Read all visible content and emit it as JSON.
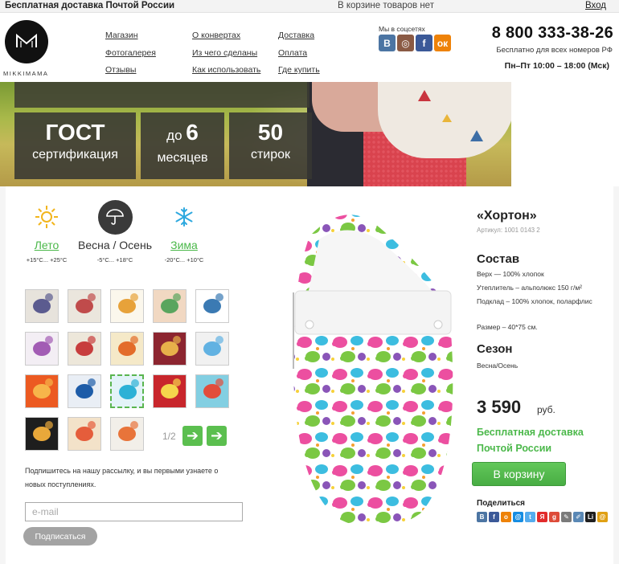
{
  "topbar": {
    "promo": "Бесплатная доставка Почтой России",
    "cart_status": "В корзине товаров нет",
    "login": "Вход"
  },
  "header": {
    "logo_text": "MIKKIMAMA",
    "nav_col1": [
      "Магазин",
      "Фотогалерея",
      "Отзывы"
    ],
    "nav_col2": [
      "О конвертах",
      "Из чего сделаны",
      "Как использовать"
    ],
    "nav_col3": [
      "Доставка",
      "Оплата",
      "Где купить"
    ],
    "social_label": "Мы в соцсетях",
    "social": [
      {
        "name": "vk-icon",
        "glyph": "B",
        "color": "#4c75a3"
      },
      {
        "name": "instagram-icon",
        "glyph": "◎",
        "color": "#8a5a44"
      },
      {
        "name": "facebook-icon",
        "glyph": "f",
        "color": "#3b5998"
      },
      {
        "name": "odnoklassniki-icon",
        "glyph": "ок",
        "color": "#ee8208"
      }
    ],
    "phone": "8 800 333-38-26",
    "phone_sub": "Бесплатно для всех номеров РФ",
    "hours": "Пн–Пт 10:00 – 18:00 (Мск)"
  },
  "hero": {
    "features": [
      {
        "big": "ГОСТ",
        "prefix": "",
        "sub": "сертификация"
      },
      {
        "big": "6",
        "prefix": "до ",
        "sub": "месяцев"
      },
      {
        "big": "50",
        "prefix": "",
        "sub": "стирок"
      }
    ]
  },
  "seasons": [
    {
      "name": "Лето",
      "temp": "+15°C... +25°C",
      "icon": "sun-icon",
      "active": false
    },
    {
      "name": "Весна / Осень",
      "temp": "-5°C... +18°C",
      "icon": "umbrella-icon",
      "active": true
    },
    {
      "name": "Зима",
      "temp": "-20°C... +10°C",
      "icon": "snowflake-icon",
      "active": false
    }
  ],
  "thumbnails": {
    "pager": "1/2",
    "selected_index": 12,
    "items": [
      {
        "name": "thumb-grey-elephants",
        "bg": "#e7e3dc",
        "accent": "#5b5b8f"
      },
      {
        "name": "thumb-grey-dots",
        "bg": "#ebe6dd",
        "accent": "#c04b4b"
      },
      {
        "name": "thumb-bib-dots",
        "bg": "#fbf7ec",
        "accent": "#e7a23a"
      },
      {
        "name": "thumb-rainbow-pattern",
        "bg": "#f1d8c2",
        "accent": "#5aa55e"
      },
      {
        "name": "thumb-blue-owls",
        "bg": "#ffffff",
        "accent": "#3b7ab3"
      },
      {
        "name": "thumb-purple-owl",
        "bg": "#f3eef4",
        "accent": "#a25cb4"
      },
      {
        "name": "thumb-scooter",
        "bg": "#ede7da",
        "accent": "#c73d3d"
      },
      {
        "name": "thumb-orange-bird",
        "bg": "#f5e9c8",
        "accent": "#e36c2a"
      },
      {
        "name": "thumb-deer-red",
        "bg": "#8c2530",
        "accent": "#e7b04a"
      },
      {
        "name": "thumb-robots",
        "bg": "#f1f1f1",
        "accent": "#62b2e2"
      },
      {
        "name": "thumb-orange-dots",
        "bg": "#ec5a21",
        "accent": "#f7b54a"
      },
      {
        "name": "thumb-blue-triangles",
        "bg": "#e9eef5",
        "accent": "#1d5ca8"
      },
      {
        "name": "thumb-elephant-selected",
        "bg": "#e3f3f8",
        "accent": "#2cb1d6"
      },
      {
        "name": "thumb-red-birds",
        "bg": "#c8262c",
        "accent": "#f5d54c"
      },
      {
        "name": "thumb-pirate-ship",
        "bg": "#83cfe2",
        "accent": "#e24d3c"
      },
      {
        "name": "thumb-black-boats",
        "bg": "#1e1e1e",
        "accent": "#e9a83a"
      },
      {
        "name": "thumb-lion",
        "bg": "#f3e2c9",
        "accent": "#e55d3b"
      },
      {
        "name": "thumb-fox",
        "bg": "#f2efe9",
        "accent": "#e8743a"
      }
    ]
  },
  "newsletter": {
    "text": "Подпишитесь на нашу рассылку, и вы первыми узнаете о новых поступлениях.",
    "placeholder": "e-mail",
    "button": "Подписаться"
  },
  "product": {
    "title": "«Хортон»",
    "sku": "Артикул: 1001 0143 2",
    "composition_heading": "Состав",
    "composition": [
      "Верх — 100% хлопок",
      "Утеплитель – альполюкс 150 г/м²",
      "Подклад – 100% хлопок, поларфлис"
    ],
    "size": "Размер – 40*75 см.",
    "season_heading": "Сезон",
    "season": "Весна/Осень",
    "price": "3 590",
    "price_unit": "руб.",
    "shipping": [
      "Бесплатная доставка",
      "Почтой России"
    ],
    "cart_button": "В корзину",
    "share_label": "Поделиться",
    "share": [
      {
        "name": "share-vk-icon",
        "glyph": "B",
        "color": "#4c75a3"
      },
      {
        "name": "share-facebook-icon",
        "glyph": "f",
        "color": "#3b5998"
      },
      {
        "name": "share-odnoklassniki-icon",
        "glyph": "o",
        "color": "#ee8208"
      },
      {
        "name": "share-mailru-icon",
        "glyph": "@",
        "color": "#168de2"
      },
      {
        "name": "share-twitter-icon",
        "glyph": "t",
        "color": "#55acee"
      },
      {
        "name": "share-yandex-icon",
        "glyph": "Я",
        "color": "#e22b2b"
      },
      {
        "name": "share-google-icon",
        "glyph": "g",
        "color": "#dd4b39"
      },
      {
        "name": "share-blogger-icon",
        "glyph": "✎",
        "color": "#7a7a7a"
      },
      {
        "name": "share-livejournal-icon",
        "glyph": "✐",
        "color": "#5a88b5"
      },
      {
        "name": "share-linkedin-icon",
        "glyph": "Li",
        "color": "#1f1f1f"
      },
      {
        "name": "share-email-icon",
        "glyph": "@",
        "color": "#e0a014"
      }
    ]
  }
}
